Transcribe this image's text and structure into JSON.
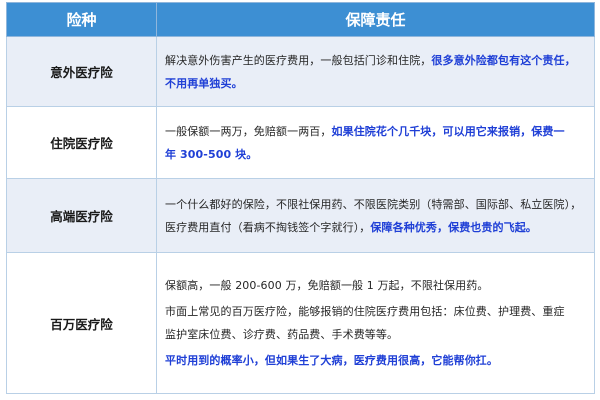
{
  "header": {
    "col_type": "险种",
    "col_coverage": "保障责任"
  },
  "rows": [
    {
      "name": "意外医疗险",
      "line1_plain": "解决意外伤害产生的医疗费用，一般包括门诊和住院，",
      "line1_highlight": "很多意外险都包有这个责任，",
      "line2_highlight": "不用再单独买。"
    },
    {
      "name": "住院医疗险",
      "line1_plain": "一般保额一两万，免赔额一两百，",
      "line1_highlight": "如果住院花个几千块，可以用它来报销，保费一",
      "line2_highlight": "年 300-500 块。"
    },
    {
      "name": "高端医疗险",
      "line1_plain": "一个什么都好的保险，不限社保用药、不限医院类别（特需部、国际部、私立医院），",
      "line2_plain": "医疗费用直付（看病不掏钱签个字就行），",
      "line2_highlight": "保障各种优秀，保费也贵的飞起。"
    },
    {
      "name": "百万医疗险",
      "line1_plain": "保额高，一般 200-600 万，免赔额一般 1 万起，不限社保用药。",
      "line2_plain": "市面上常见的百万医疗险，能够报销的住院医疗费用包括：床位费、护理费、重症",
      "line3_plain": "监护室床位费、诊疗费、药品费、手术费等等。",
      "line4_highlight": "平时用到的概率小，但如果生了大病，医疗费用很高，它能帮你扛。"
    }
  ],
  "colors": {
    "header_bg": "#3d8fd3",
    "highlight_text": "#1f3fd6",
    "odd_row_bg": "#e9eef7"
  }
}
